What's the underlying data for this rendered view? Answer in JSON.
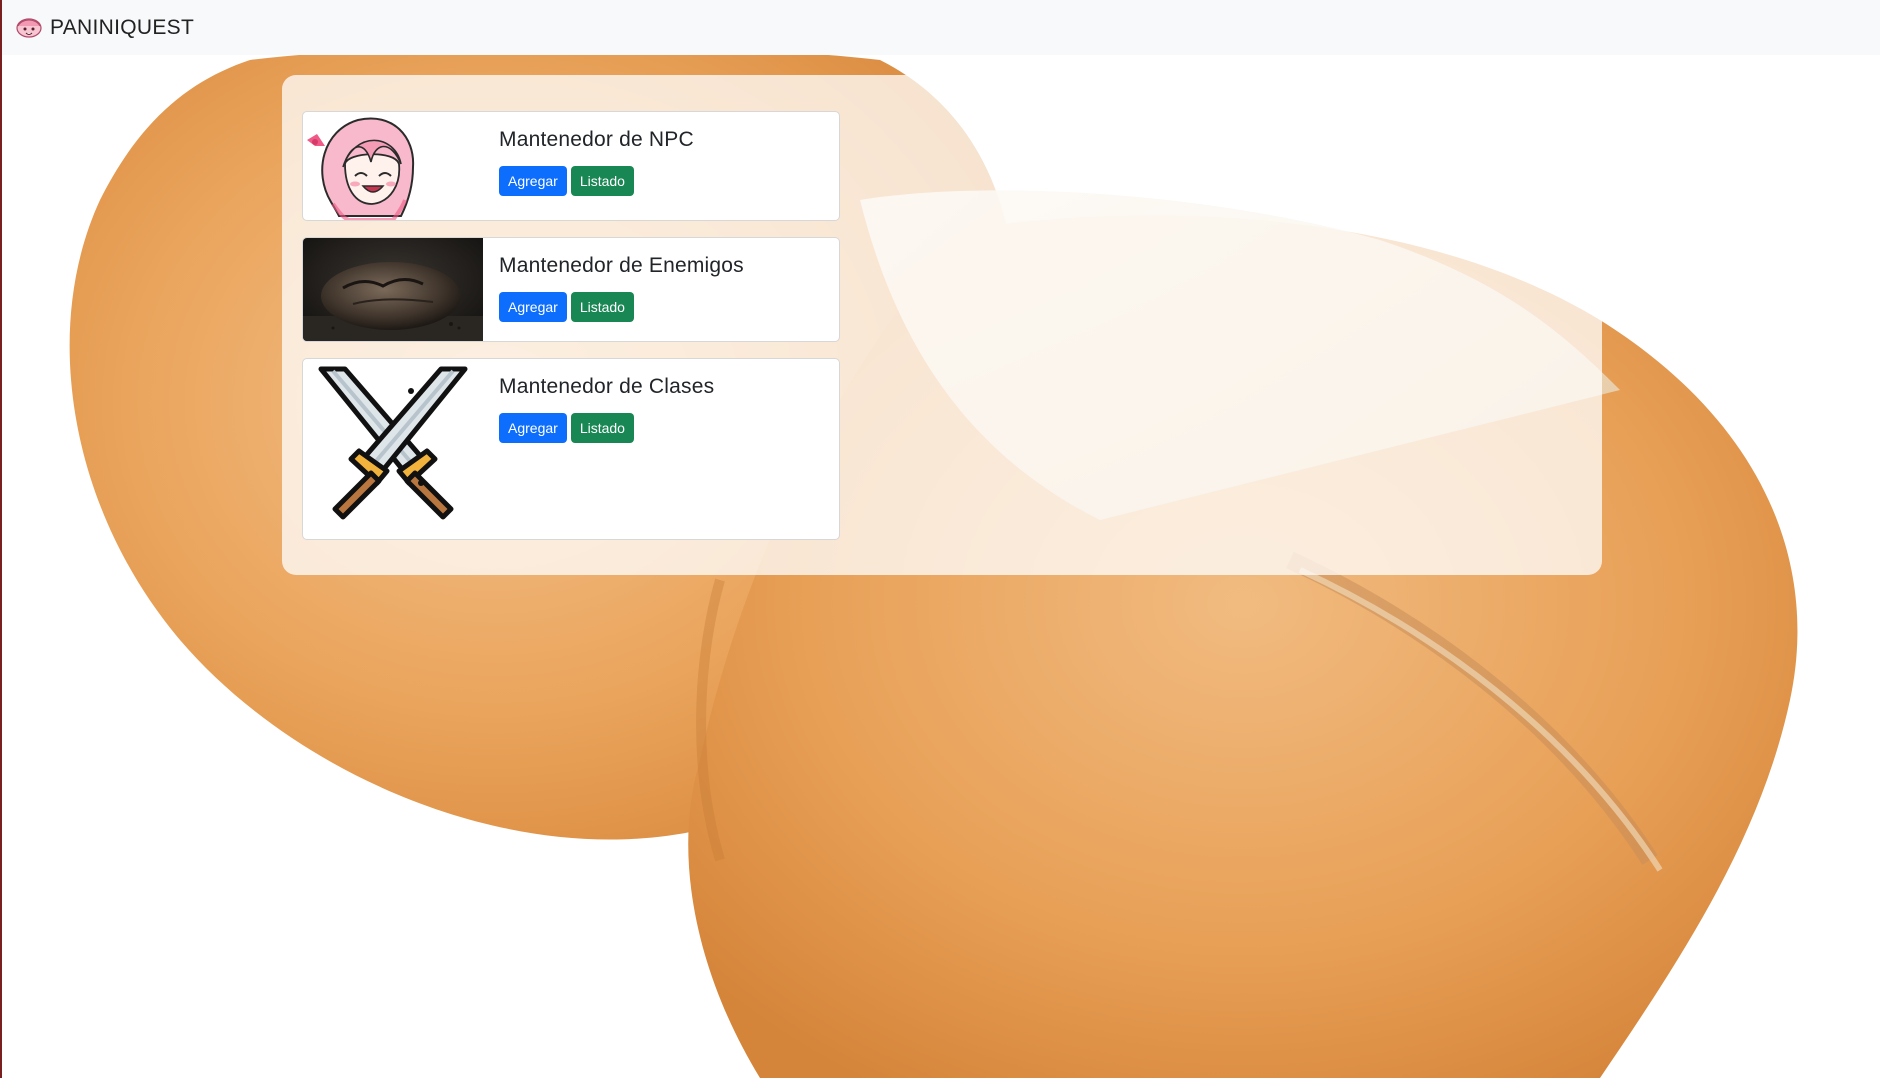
{
  "navbar": {
    "brand_text": "PANINIQUEST",
    "logo_icon": "anime-girl-logo-icon"
  },
  "cards": [
    {
      "title": "Mantenedor de NPC",
      "image_icon": "anime-girl-icon",
      "add_label": "Agregar",
      "list_label": "Listado"
    },
    {
      "title": "Mantenedor de Enemigos",
      "image_icon": "burnt-bread-icon",
      "add_label": "Agregar",
      "list_label": "Listado"
    },
    {
      "title": "Mantenedor de Clases",
      "image_icon": "crossed-swords-icon",
      "add_label": "Agregar",
      "list_label": "Listado"
    }
  ],
  "colors": {
    "primary": "#0d6efd",
    "success": "#198754",
    "navbar_bg": "#f8f9fa",
    "bread": "#e9a55a"
  }
}
